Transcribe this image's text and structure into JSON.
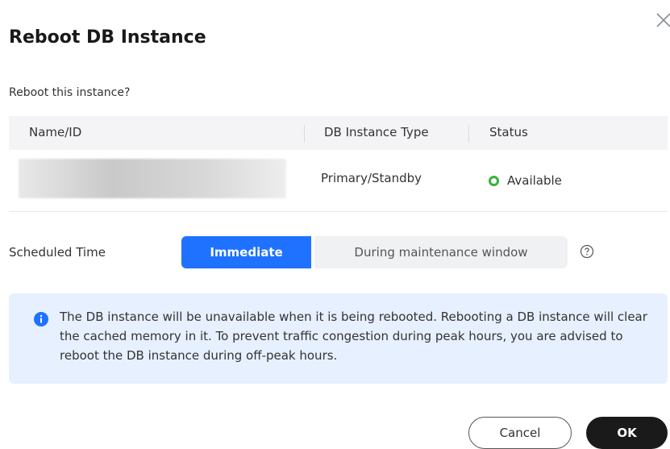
{
  "dialog": {
    "title": "Reboot DB Instance",
    "question": "Reboot this instance?"
  },
  "table": {
    "headers": [
      "Name/ID",
      "DB Instance Type",
      "Status"
    ],
    "rows": [
      {
        "type": "Primary/Standby",
        "status": "Available"
      }
    ]
  },
  "schedule": {
    "label": "Scheduled Time",
    "options": [
      "Immediate",
      "During maintenance window"
    ],
    "selected": "Immediate"
  },
  "alert": {
    "text": "The DB instance will be unavailable when it is being rebooted. Rebooting a DB instance will clear the cached memory in it. To prevent traffic congestion during peak hours, you are advised to reboot the DB instance during off-peak hours."
  },
  "buttons": {
    "cancel": "Cancel",
    "ok": "OK"
  },
  "icons": {
    "close": "close-icon",
    "help": "help-circle-icon",
    "info": "info-circle-icon",
    "status": "status-ring-icon"
  },
  "colors": {
    "primary": "#1e72ff",
    "status_available": "#3ab13a",
    "alert_background": "#e7f0fe",
    "ok_button": "#1a1a1a"
  }
}
